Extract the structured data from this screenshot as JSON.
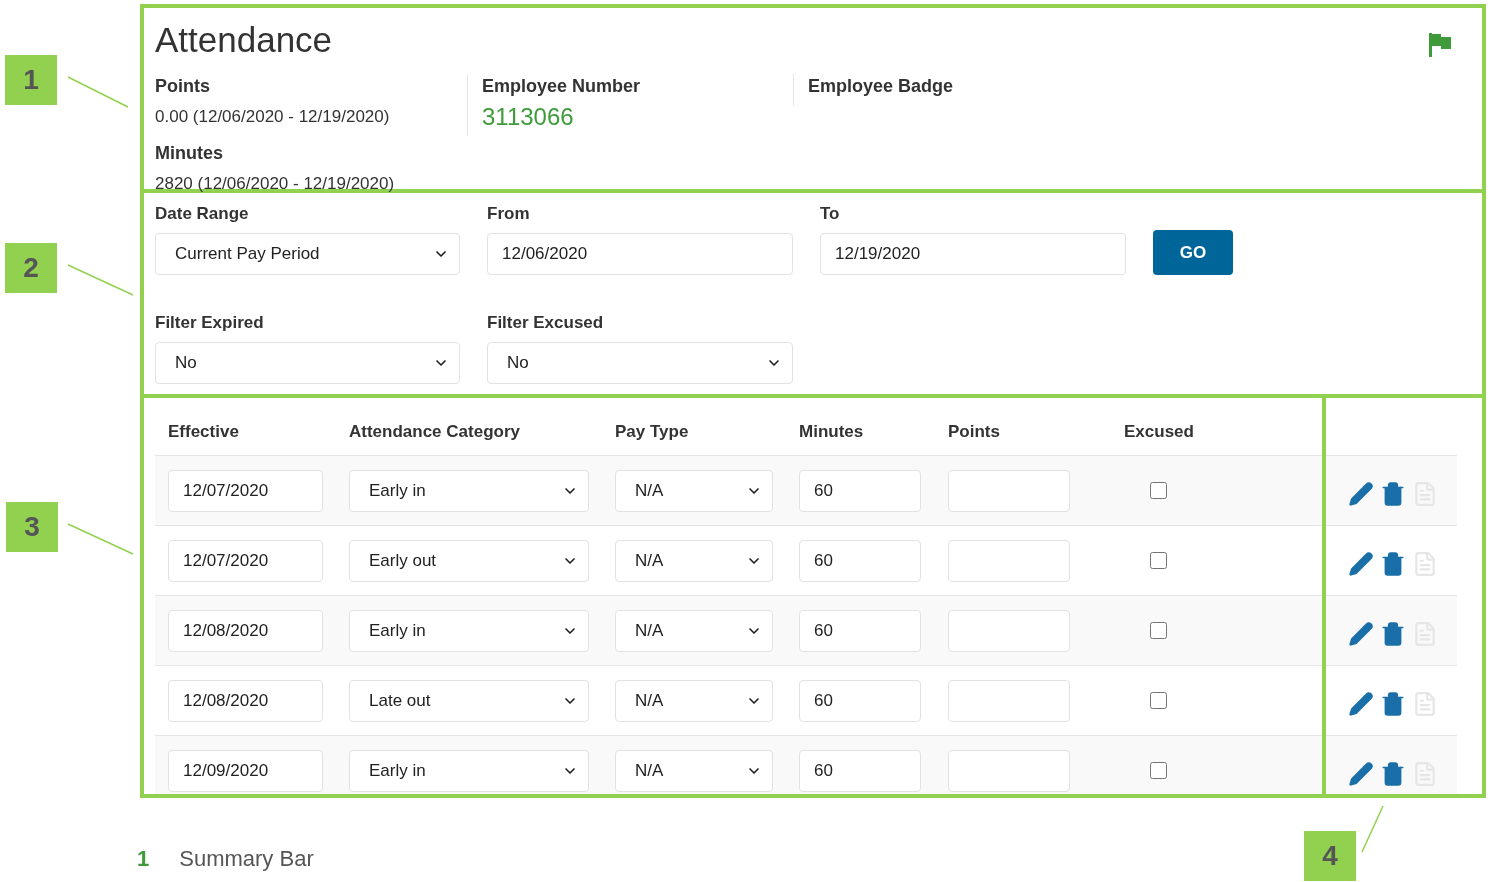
{
  "summary": {
    "title": "Attendance",
    "points": {
      "label": "Points",
      "value": "0.00 (12/06/2020 - 12/19/2020)"
    },
    "minutes": {
      "label": "Minutes",
      "value": "2820 (12/06/2020 - 12/19/2020)"
    },
    "employee_number": {
      "label": "Employee Number",
      "value": "3113066"
    },
    "employee_badge": {
      "label": "Employee Badge"
    }
  },
  "filters": {
    "date_range": {
      "label": "Date Range",
      "value": "Current Pay Period"
    },
    "from": {
      "label": "From",
      "value": "12/06/2020"
    },
    "to": {
      "label": "To",
      "value": "12/19/2020"
    },
    "go_button": "GO",
    "filter_expired": {
      "label": "Filter Expired",
      "value": "No"
    },
    "filter_excused": {
      "label": "Filter Excused",
      "value": "No"
    }
  },
  "table": {
    "columns": [
      "Effective",
      "Attendance Category",
      "Pay Type",
      "Minutes",
      "Points",
      "Excused"
    ],
    "rows": [
      {
        "effective": "12/07/2020",
        "category": "Early in",
        "pay_type": "N/A",
        "minutes": "60",
        "excused": false
      },
      {
        "effective": "12/07/2020",
        "category": "Early out",
        "pay_type": "N/A",
        "minutes": "60",
        "excused": false
      },
      {
        "effective": "12/08/2020",
        "category": "Early in",
        "pay_type": "N/A",
        "minutes": "60",
        "excused": false
      },
      {
        "effective": "12/08/2020",
        "category": "Late out",
        "pay_type": "N/A",
        "minutes": "60",
        "excused": false
      },
      {
        "effective": "12/09/2020",
        "category": "Early in",
        "pay_type": "N/A",
        "minutes": "60",
        "excused": false
      }
    ]
  },
  "callouts": [
    "1",
    "2",
    "3",
    "4"
  ],
  "legend": [
    {
      "number": "1",
      "label": "Summary Bar"
    }
  ]
}
